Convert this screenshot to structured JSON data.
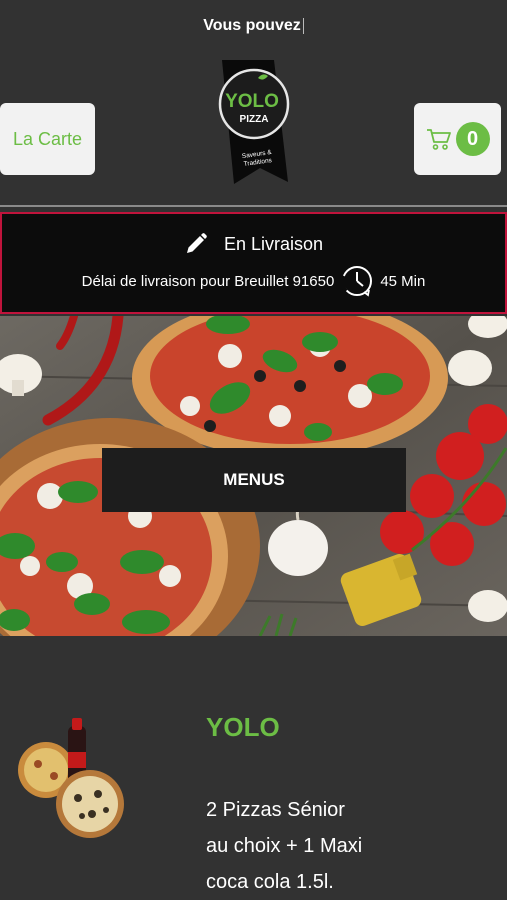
{
  "top_banner": {
    "text": "Vous pouvez"
  },
  "header": {
    "carte_label": "La Carte",
    "cart_count": "0",
    "logo": {
      "name": "YOLO",
      "sub": "PIZZA",
      "tagline_1": "Saveurs &",
      "tagline_2": "Traditions"
    }
  },
  "delivery": {
    "mode": "En Livraison",
    "delay_text": "Délai de livraison pour Breuillet 91650",
    "delay_time": "45 Min"
  },
  "hero": {
    "menus_label": "MENUS"
  },
  "menu_item": {
    "title": "YOLO",
    "desc_line1": "2 Pizzas Sénior",
    "desc_line2": "au choix + 1 Maxi",
    "desc_line3": "coca cola 1.5l."
  },
  "colors": {
    "accent": "#6cbd45",
    "delivery_border": "#c0143c",
    "background": "#323232"
  },
  "icons": [
    "pencil-icon",
    "clock-icon",
    "cart-icon"
  ]
}
